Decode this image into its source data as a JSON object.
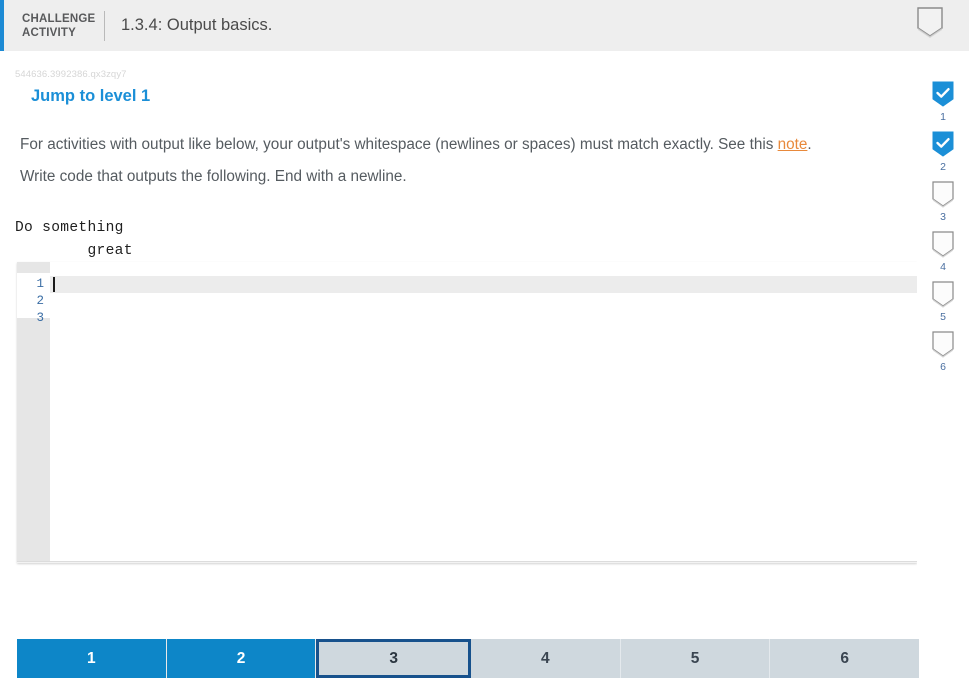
{
  "header": {
    "kicker_line1": "CHALLENGE",
    "kicker_line2": "ACTIVITY",
    "title": "1.3.4: Output basics.",
    "marker_icon": "pentagon-bookmark-icon",
    "accent_color": "#1c8ad4",
    "background_color": "#eeeeee"
  },
  "activity": {
    "id_text": "544636.3992386.qx3zqy7",
    "jump_to_level": "Jump to level 1",
    "jump_to_level_color": "#1b8fd7",
    "paragraph_1_before_link": "For activities with output like below, your output's whitespace (newlines or spaces) must match exactly. See this ",
    "paragraph_1_link": "note",
    "paragraph_1_after_link": ".",
    "link_color": "#e8893b",
    "paragraph_2": "Write code that outputs the following. End with a newline.",
    "sample_output": "Do something\n        great"
  },
  "editor": {
    "line_numbers": [
      "1",
      "2",
      "3"
    ],
    "lines": [
      "",
      "",
      ""
    ],
    "cursor_line": 1,
    "cursor_column": 1,
    "active_line_color": "#ececec",
    "gutter_color": "#e6e6e6",
    "line_number_color": "#3b6ea5"
  },
  "tabs": [
    {
      "label": "1",
      "state": "done"
    },
    {
      "label": "2",
      "state": "done"
    },
    {
      "label": "3",
      "state": "current"
    },
    {
      "label": "4",
      "state": "todo"
    },
    {
      "label": "5",
      "state": "todo"
    },
    {
      "label": "6",
      "state": "todo"
    }
  ],
  "tab_colors": {
    "done": "#0d86c8",
    "todo": "#cfd8de",
    "current_border": "#17518c"
  },
  "progress_rail": [
    {
      "number": "1",
      "checked": true
    },
    {
      "number": "2",
      "checked": true
    },
    {
      "number": "3",
      "checked": false
    },
    {
      "number": "4",
      "checked": false
    },
    {
      "number": "5",
      "checked": false
    },
    {
      "number": "6",
      "checked": false
    }
  ],
  "progress_colors": {
    "checked_fill": "#1b8fd7",
    "unchecked_stroke": "#8a8a8a",
    "number_color": "#4a6fa0"
  }
}
